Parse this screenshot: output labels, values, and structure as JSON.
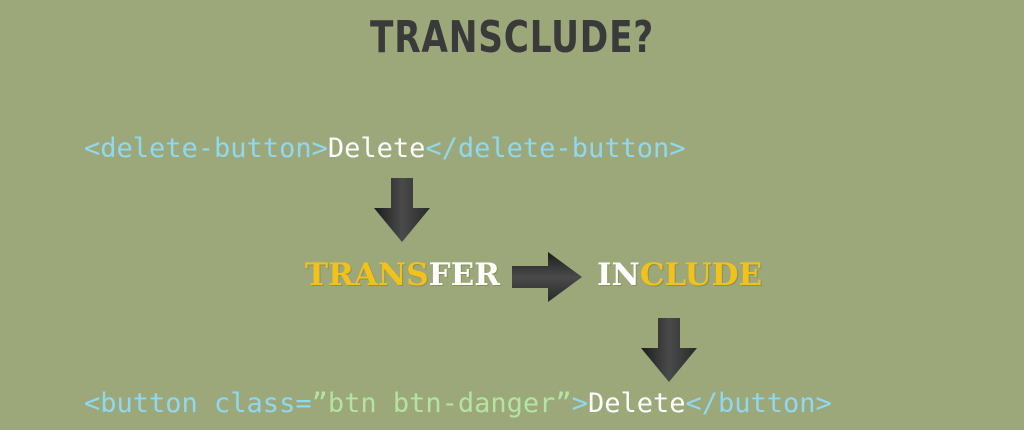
{
  "title": "TRANSCLUDE?",
  "source_code": {
    "open_tag": "<delete-button>",
    "text": "Delete",
    "close_tag": "</delete-button>"
  },
  "output_code": {
    "open_tag_start": "<button class=",
    "attr_value": "”btn btn-danger”",
    "open_tag_end": ">",
    "text": "Delete",
    "close_tag": "</button>"
  },
  "word_transfer": {
    "highlight": "TRANS",
    "rest": "FER"
  },
  "word_include": {
    "highlight": "IN",
    "rest": "CLUDE"
  },
  "icons": {
    "down_arrow": "arrow-down-icon",
    "right_arrow": "arrow-right-icon"
  },
  "colors": {
    "background": "#9ca87a",
    "title": "#3a3a3a",
    "tag": "#8fd8f0",
    "text": "#ffffff",
    "string": "#b4e3a2",
    "highlight": "#f2c21a"
  }
}
